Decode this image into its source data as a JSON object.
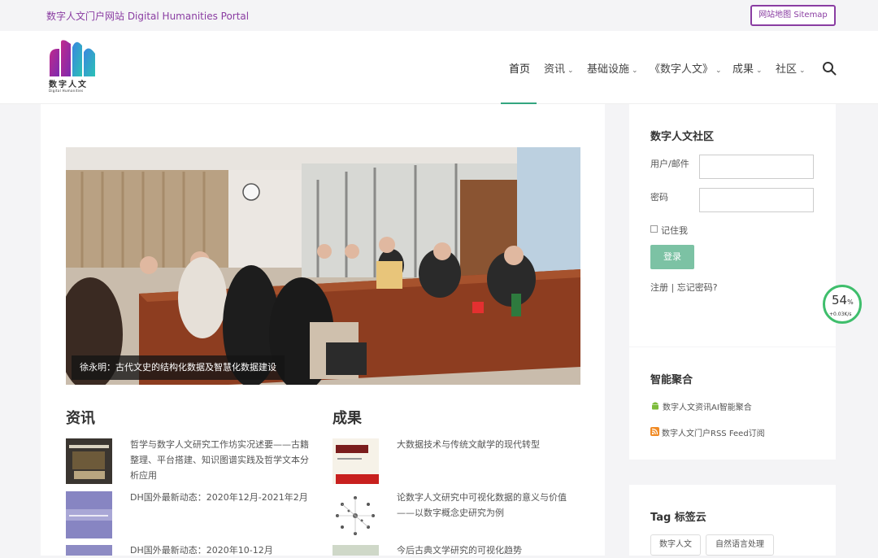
{
  "topbar": {
    "site_name": "数字人文门户网站 Digital Humanities Portal",
    "sitemap": "网站地图 Sitemap"
  },
  "logo": {
    "name": "数字人文",
    "sub": "Digital Humanities"
  },
  "nav": [
    {
      "label": "首页",
      "active": true
    },
    {
      "label": "资讯"
    },
    {
      "label": "基础设施"
    },
    {
      "label": "《数字人文》"
    },
    {
      "label": "成果"
    },
    {
      "label": "社区"
    }
  ],
  "hero": {
    "caption": "徐永明：古代文史的结构化数据及智慧化数据建设"
  },
  "news": {
    "title": "资讯",
    "items": [
      {
        "text": "哲学与数字人文研究工作坊实况述要——古籍整理、平台搭建、知识图谱实践及哲学文本分析应用",
        "thumb": "宋元學案知識圖譜"
      },
      {
        "text": "DH国外最新动态：2020年12月-2021年2月",
        "thumb": "DH最新动态"
      },
      {
        "text": "DH国外最新动态：2020年10-12月",
        "thumb": ""
      }
    ]
  },
  "results": {
    "title": "成果",
    "items": [
      {
        "text": "大数据技术与传统文献学的现代转型",
        "thumb": "中国社会科学"
      },
      {
        "text": "论数字人文研究中可视化数据的意义与价值——以数字概念史研究为例"
      },
      {
        "text": "今后古典文学研究的可视化趋势"
      }
    ]
  },
  "community": {
    "title": "数字人文社区",
    "user_label": "用户/邮件",
    "pass_label": "密码",
    "remember": "记住我",
    "login": "登录",
    "links": "注册 | 忘记密码?"
  },
  "aggregate": {
    "title": "智能聚合",
    "items": [
      "数字人文资讯AI智能聚合",
      "数字人文门户RSS Feed订阅"
    ]
  },
  "tags": {
    "title": "Tag 标签云",
    "items": [
      "数字人文",
      "自然语言处理"
    ]
  },
  "speed": {
    "percent": "54",
    "unit": "%",
    "rate": "+0.03K/s"
  },
  "colors": {
    "accent": "#8a3da2",
    "green": "#33a680"
  }
}
